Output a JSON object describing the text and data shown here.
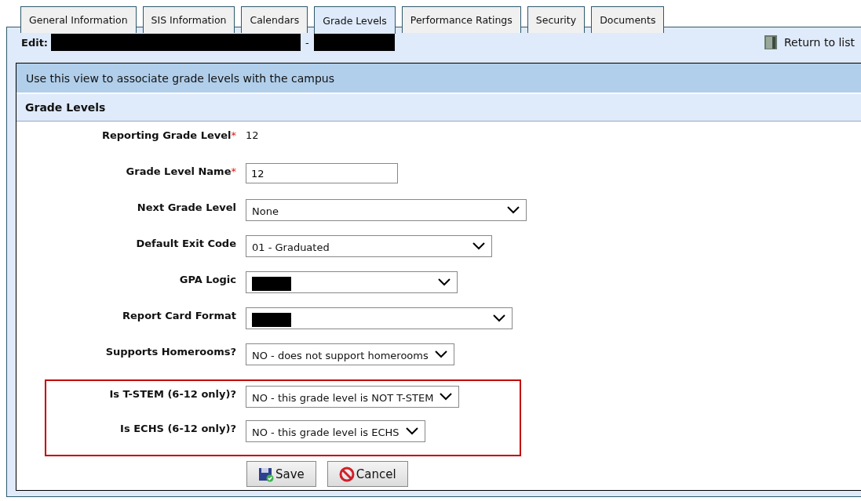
{
  "tabs": [
    {
      "label": "General Information",
      "selected": false
    },
    {
      "label": "SIS Information",
      "selected": false
    },
    {
      "label": "Calendars",
      "selected": false
    },
    {
      "label": "Grade Levels",
      "selected": true
    },
    {
      "label": "Performance Ratings",
      "selected": false
    },
    {
      "label": "Security",
      "selected": false
    },
    {
      "label": "Documents",
      "selected": false
    }
  ],
  "edit_bar": {
    "label": "Edit:",
    "separator": "-",
    "return_link": "Return to list"
  },
  "instructions": "Use this view to associate grade levels with the campus",
  "section_title": "Grade Levels",
  "fields": [
    {
      "kind": "static",
      "label": "Reporting Grade Level",
      "required_mark": "*",
      "value": "12"
    },
    {
      "kind": "text",
      "label": "Grade Level Name",
      "required_mark": "*",
      "value": "12"
    },
    {
      "kind": "select",
      "label": "Next Grade Level",
      "value": "None"
    },
    {
      "kind": "select",
      "label": "Default Exit Code",
      "value": "01 - Graduated"
    },
    {
      "kind": "select",
      "label": "GPA Logic",
      "redacted": true
    },
    {
      "kind": "select",
      "label": "Report Card Format",
      "redacted": true
    },
    {
      "kind": "select",
      "label": "Supports Homerooms?",
      "value": "NO - does not support homerooms"
    }
  ],
  "highlighted_fields": [
    {
      "kind": "select",
      "label": "Is T-STEM (6-12 only)?",
      "value": "NO - this grade level is NOT T-STEM"
    },
    {
      "kind": "select",
      "label": "Is ECHS (6-12 only)?",
      "value": "NO - this grade level is ECHS"
    }
  ],
  "buttons": [
    {
      "kind": "save",
      "label": "Save"
    },
    {
      "kind": "cancel",
      "label": "Cancel"
    }
  ]
}
